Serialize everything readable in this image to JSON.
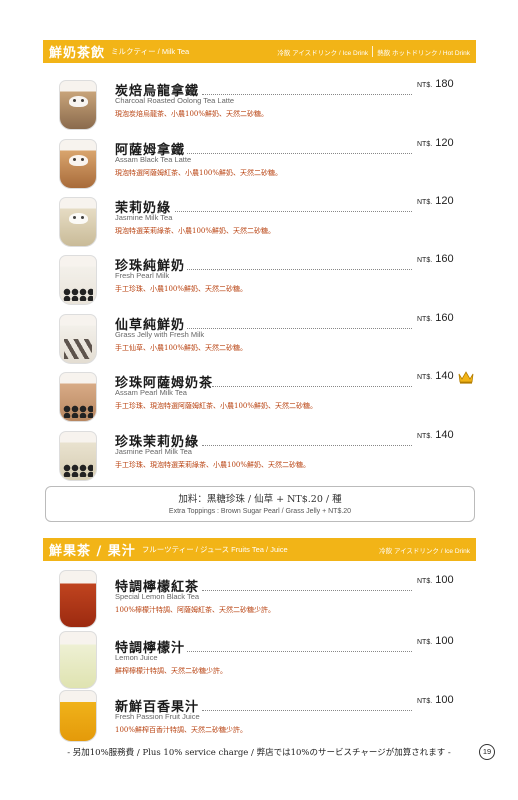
{
  "section1": {
    "title": "鮮奶茶飲",
    "subtitle": "ミルクティー / Milk Tea",
    "cold_label": "冷飲 アイスドリンク / Ice Drink",
    "hot_label": "熱飲 ホットドリンク / Hot Drink"
  },
  "items1": [
    {
      "name": "炭焙烏龍拿鐵",
      "en": "Charcoal Roasted Oolong Tea Latte",
      "desc": "現泡炭焙烏龍茶、小農100%鮮奶、天然二砂糖。",
      "currency": "NT$.",
      "price": "180"
    },
    {
      "name": "阿薩姆拿鐵",
      "en": "Assam Black Tea Latte",
      "desc": "現泡特選阿薩姆紅茶、小農100%鮮奶、天然二砂糖。",
      "currency": "NT$.",
      "price": "120"
    },
    {
      "name": "茉莉奶綠",
      "en": "Jasmine Milk Tea",
      "desc": "現泡特選茉莉綠茶、小農100%鮮奶、天然二砂糖。",
      "currency": "NT$.",
      "price": "120"
    },
    {
      "name": "珍珠純鮮奶",
      "en": "Fresh Pearl Milk",
      "desc": "手工珍珠、小農100%鮮奶、天然二砂糖。",
      "currency": "NT$.",
      "price": "160"
    },
    {
      "name": "仙草純鮮奶",
      "en": "Grass Jelly with Fresh Milk",
      "desc": "手工仙草、小農100%鮮奶、天然二砂糖。",
      "currency": "NT$.",
      "price": "160"
    },
    {
      "name": "珍珠阿薩姆奶茶",
      "en": "Assam Pearl Milk Tea",
      "desc": "手工珍珠、現泡特選阿薩姆紅茶、小農100%鮮奶、天然二砂糖。",
      "currency": "NT$.",
      "price": "140"
    },
    {
      "name": "珍珠茉莉奶綠",
      "en": "Jasmine Pearl Milk Tea",
      "desc": "手工珍珠、現泡特選茉莉綠茶、小農100%鮮奶、天然二砂糖。",
      "currency": "NT$.",
      "price": "140"
    }
  ],
  "toppings": {
    "line1": "加料：黑糖珍珠 / 仙草 + NT$.20 / 種",
    "line2": "Extra Toppings : Brown Sugar Pearl / Grass Jelly + NT$.20"
  },
  "section2": {
    "title": "鮮果茶 / 果汁",
    "subtitle": "フルーツティー / ジュース Fruits Tea / Juice",
    "cold_label": "冷飲 アイスドリンク / Ice Drink"
  },
  "items2": [
    {
      "name": "特調檸檬紅茶",
      "en": "Special Lemon Black Tea",
      "desc": "100%檸檬汁特調、阿薩姆紅茶、天然二砂糖少許。",
      "currency": "NT$.",
      "price": "100"
    },
    {
      "name": "特調檸檬汁",
      "en": "Lemon Juice",
      "desc": "鮮榨檸檬汁特調、天然二砂糖少許。",
      "currency": "NT$.",
      "price": "100"
    },
    {
      "name": "新鮮百香果汁",
      "en": "Fresh Passion Fruit Juice",
      "desc": "100%鮮榨百香汁特調、天然二砂糖少許。",
      "currency": "NT$.",
      "price": "100"
    }
  ],
  "footer": "- 另加10%服務費 / Plus 10% service charge / 弊店では10%のサービスチャージが加算されます -",
  "page_number": "19",
  "colors": {
    "accent": "#f2b417",
    "desc": "#b8410f"
  },
  "icons": {
    "crown": "crown-icon"
  }
}
